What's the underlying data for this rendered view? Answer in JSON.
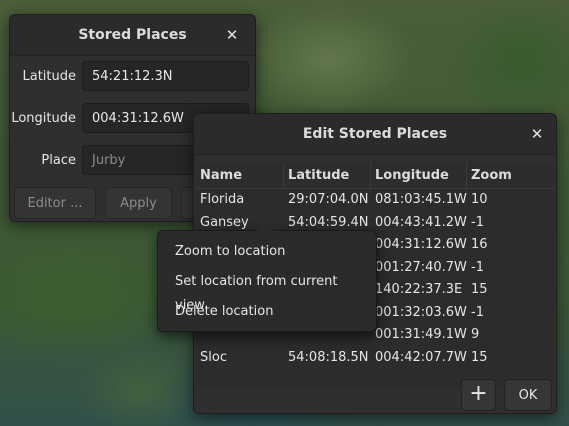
{
  "stored_places": {
    "title": "Stored Places",
    "close_glyph": "✕",
    "latitude_label": "Latitude",
    "latitude_value": "54:21:12.3N",
    "longitude_label": "Longitude",
    "longitude_value": "004:31:12.6W",
    "place_label": "Place",
    "place_placeholder": "Jurby",
    "editor_button": "Editor ...",
    "apply_button": "Apply"
  },
  "edit_stored_places": {
    "title": "Edit Stored Places",
    "close_glyph": "✕",
    "columns": [
      "Name",
      "Latitude",
      "Longitude",
      "Zoom"
    ],
    "rows": [
      {
        "name": "Florida",
        "latitude": "29:07:04.0N",
        "longitude": "081:03:45.1W",
        "zoom": "10"
      },
      {
        "name": "Gansey",
        "latitude": "54:04:59.4N",
        "longitude": "004:43:41.2W",
        "zoom": "-1"
      },
      {
        "name": "",
        "latitude": "",
        "longitude": "004:31:12.6W",
        "zoom": "16"
      },
      {
        "name": "",
        "latitude": "",
        "longitude": "001:27:40.7W",
        "zoom": "-1"
      },
      {
        "name": "",
        "latitude": "",
        "longitude": "140:22:37.3E",
        "zoom": "15"
      },
      {
        "name": "",
        "latitude": "",
        "longitude": "001:32:03.6W",
        "zoom": "-1"
      },
      {
        "name": "",
        "latitude": "",
        "longitude": "001:31:49.1W",
        "zoom": "9"
      },
      {
        "name": "Sloc",
        "latitude": "54:08:18.5N",
        "longitude": "004:42:07.7W",
        "zoom": "15"
      }
    ],
    "add_glyph": "+",
    "ok_button": "OK"
  },
  "context_menu": {
    "items": [
      "Zoom to location",
      "Set location from current view",
      "Delete location"
    ]
  }
}
